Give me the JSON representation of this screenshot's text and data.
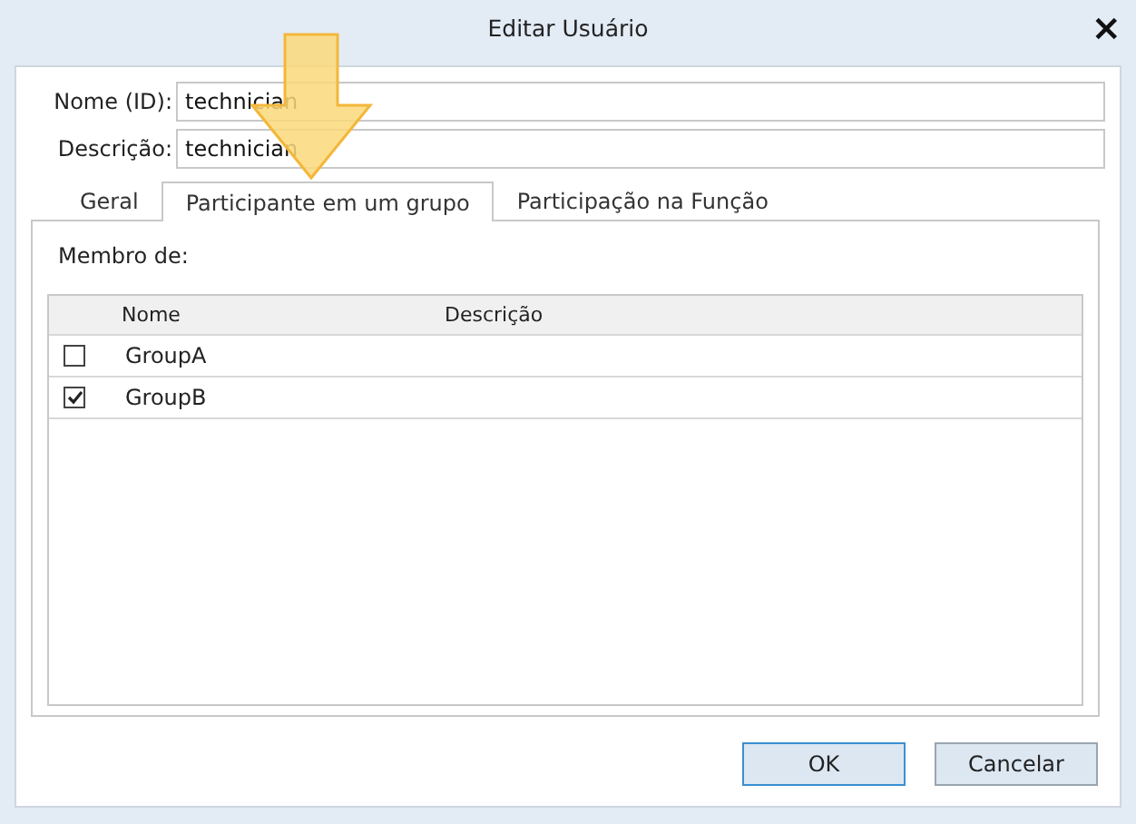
{
  "window": {
    "title": "Editar Usuário",
    "close": "×"
  },
  "fields": [
    {
      "label": "Nome (ID):",
      "value": "technician"
    },
    {
      "label": "Descrição:",
      "value": "technician"
    }
  ],
  "tabs": [
    {
      "label": "Geral",
      "selected": false
    },
    {
      "label": "Participante em um grupo",
      "selected": true
    },
    {
      "label": "Participação na Função",
      "selected": false
    }
  ],
  "member_of_label": "Membro de:",
  "table": {
    "columns": [
      "Nome",
      "Descrição"
    ],
    "rows": [
      {
        "checked": false,
        "name": "GroupA"
      },
      {
        "checked": true,
        "name": "GroupB"
      }
    ]
  },
  "buttons": [
    {
      "label": "OK",
      "selected": true
    },
    {
      "label": "Cancelar",
      "selected": false
    }
  ]
}
